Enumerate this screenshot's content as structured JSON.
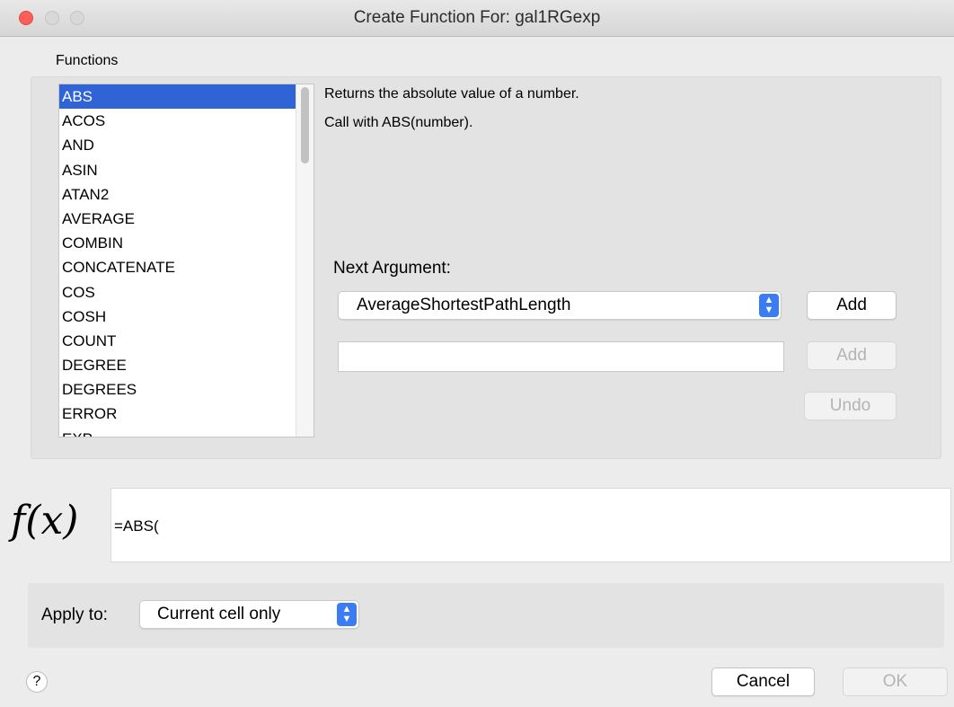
{
  "window": {
    "title": "Create Function For: gal1RGexp"
  },
  "functions": {
    "label": "Functions",
    "items": [
      "ABS",
      "ACOS",
      "AND",
      "ASIN",
      "ATAN2",
      "AVERAGE",
      "COMBIN",
      "CONCATENATE",
      "COS",
      "COSH",
      "COUNT",
      "DEGREE",
      "DEGREES",
      "ERROR",
      "EXP"
    ],
    "selected": "ABS"
  },
  "description": {
    "line1": "Returns the absolute value of a number.",
    "line2": "Call with ABS(number)."
  },
  "next_argument": {
    "label": "Next Argument:",
    "selected": "AverageShortestPathLength",
    "add_label": "Add",
    "input_value": "",
    "add2_label": "Add",
    "undo_label": "Undo"
  },
  "formula": {
    "icon": "f(x)",
    "value": "=ABS("
  },
  "apply": {
    "label": "Apply to:",
    "selected": "Current cell only"
  },
  "footer": {
    "help_label": "?",
    "cancel_label": "Cancel",
    "ok_label": "OK"
  },
  "colors": {
    "selection": "#2f63d6",
    "select_accent": "#3b7cf4",
    "close": "#fc5f57"
  }
}
